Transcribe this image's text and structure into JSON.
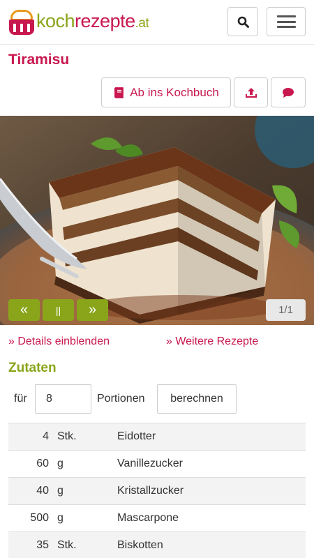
{
  "header": {
    "logo": {
      "part1": "koch",
      "part2": "rezepte",
      "tld": ".at"
    }
  },
  "recipe": {
    "title": "Tiramisu",
    "actions": {
      "cookbook_label": "Ab ins Kochbuch"
    }
  },
  "gallery": {
    "prev_label": "«",
    "pause_label": "||",
    "next_label": "»",
    "counter": "1/1"
  },
  "links": {
    "details": "» Details einblenden",
    "more": "» Weitere Rezepte"
  },
  "ingredients": {
    "heading": "Zutaten",
    "for_label": "für",
    "portions_value": "8",
    "portions_label": "Portionen",
    "calculate_label": "berechnen",
    "items": [
      {
        "amount": "4",
        "unit": "Stk.",
        "name": "Eidotter"
      },
      {
        "amount": "60",
        "unit": "g",
        "name": "Vanillezucker"
      },
      {
        "amount": "40",
        "unit": "g",
        "name": "Kristallzucker"
      },
      {
        "amount": "500",
        "unit": "g",
        "name": "Mascarpone"
      },
      {
        "amount": "35",
        "unit": "Stk.",
        "name": "Biskotten"
      }
    ]
  },
  "colors": {
    "brand_red": "#c8174f",
    "brand_green": "#8aa51a",
    "border": "#cccccc"
  },
  "icons": [
    "search-icon",
    "hamburger-menu-icon",
    "book-icon",
    "share-upload-icon",
    "comment-icon"
  ]
}
